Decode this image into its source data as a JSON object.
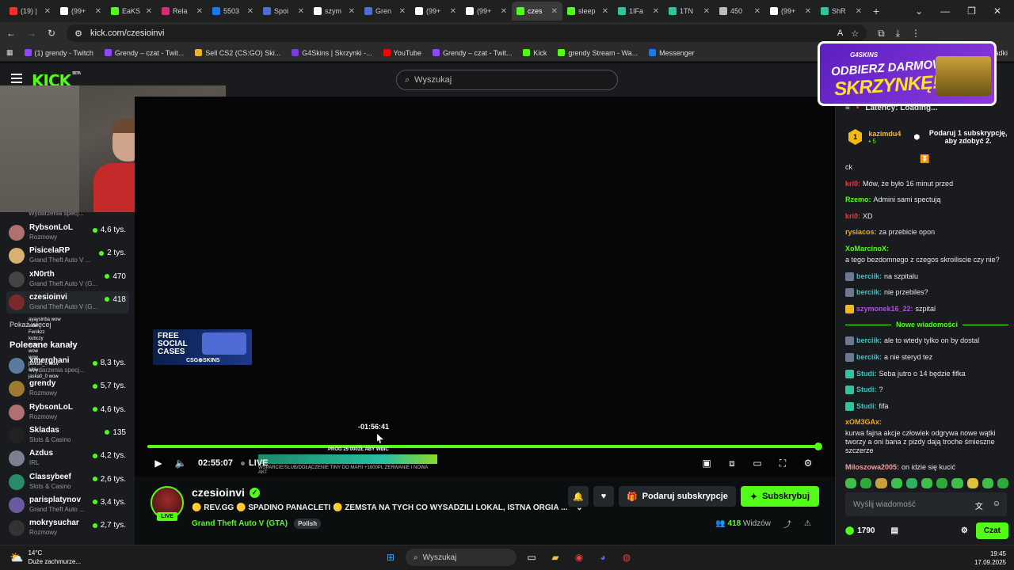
{
  "browser": {
    "tabs": [
      {
        "label": "(19) |",
        "color": "#ff2a2a"
      },
      {
        "label": "(99+",
        "color": "#ffffff"
      },
      {
        "label": "EaKS",
        "color": "#53fc18"
      },
      {
        "label": "Rela",
        "color": "#d62976"
      },
      {
        "label": "5503",
        "color": "#1877f2"
      },
      {
        "label": "Spoi",
        "color": "#4f6bd6"
      },
      {
        "label": "szym",
        "color": "#ffffff"
      },
      {
        "label": "Gren",
        "color": "#4f6bd6"
      },
      {
        "label": "(99+",
        "color": "#ffffff"
      },
      {
        "label": "(99+",
        "color": "#ffffff"
      },
      {
        "label": "czes",
        "color": "#53fc18",
        "active": true
      },
      {
        "label": "sleep",
        "color": "#53fc18"
      },
      {
        "label": "1IFa",
        "color": "#2ec4a0"
      },
      {
        "label": "1TN",
        "color": "#2ec4a0"
      },
      {
        "label": "450",
        "color": "#bbbbbb"
      },
      {
        "label": "(99+",
        "color": "#ffffff"
      },
      {
        "label": "ShR",
        "color": "#2ec4a0"
      }
    ],
    "url": "kick.com/czesioinvi",
    "bookmarks": [
      {
        "label": "(1) grendy - Twitch",
        "color": "#9146ff"
      },
      {
        "label": "Grendy – czat - Twit...",
        "color": "#9146ff"
      },
      {
        "label": "Sell CS2 (CS:GO) Ski...",
        "color": "#e8b52a"
      },
      {
        "label": "G4Skins | Skrzynki -...",
        "color": "#7b3ce0"
      },
      {
        "label": "YouTube",
        "color": "#ff0000"
      },
      {
        "label": "Grendy – czat - Twit...",
        "color": "#9146ff"
      },
      {
        "label": "Kick",
        "color": "#53fc18"
      },
      {
        "label": "grendy Stream - Wa...",
        "color": "#53fc18"
      },
      {
        "label": "Messenger",
        "color": "#1877f2"
      }
    ],
    "all_bookmarks_label": "tkie zakładki"
  },
  "kick": {
    "search_placeholder": "Wyszukaj"
  },
  "sidebar": {
    "top_partial": {
      "category": "Wydarzenia specj..."
    },
    "channels_top": [
      {
        "name": "RybsonLoL",
        "category": "Rozmowy",
        "viewers": "4,6 tys.",
        "color": "#b07070"
      },
      {
        "name": "PisicelaRP",
        "category": "Grand Theft Auto V ...",
        "viewers": "2 tys.",
        "color": "#d8b070"
      },
      {
        "name": "xN0rth",
        "category": "Grand Theft Auto V (G...",
        "viewers": "470",
        "color": "#444"
      },
      {
        "name": "czesioinvi",
        "category": "Grand Theft Auto V (G...",
        "viewers": "418",
        "color": "#7a2a2a",
        "selected": true
      }
    ],
    "show_more": "Pokaż więcej",
    "recommended_title": "Polecane kanały",
    "channels_rec": [
      {
        "name": "xmerghani",
        "category": "Wydarzenia specj...",
        "viewers": "8,3 tys.",
        "color": "#5a7aa0"
      },
      {
        "name": "grendy",
        "category": "Rozmowy",
        "viewers": "5,7 tys.",
        "color": "#a07a30"
      },
      {
        "name": "RybsonLoL",
        "category": "Rozmowy",
        "viewers": "4,6 tys.",
        "color": "#b07070"
      },
      {
        "name": "Skladas",
        "category": "Slots & Casino",
        "viewers": "135",
        "color": "#222"
      },
      {
        "name": "Azdus",
        "category": "IRL",
        "viewers": "4,2 tys.",
        "color": "#7a8090"
      },
      {
        "name": "Classybeef",
        "category": "Slots & Casino",
        "viewers": "2,6 tys.",
        "color": "#2a8a6a"
      },
      {
        "name": "parisplatynov",
        "category": "Grand Theft Auto ...",
        "viewers": "3,4 tys.",
        "color": "#6a5aa0"
      },
      {
        "name": "mokrysuchar",
        "category": "Rozmowy",
        "viewers": "2,7 tys.",
        "color": "#333"
      }
    ],
    "overlay_chat": [
      "ayaysinba wow",
      "wow",
      "Fenikzz",
      "kubczy",
      "wow",
      "wow",
      "wow",
      "jaska0_0 wow",
      "wow",
      "jaska0_0 wow"
    ]
  },
  "player": {
    "promo_title": "FREE SOCIAL CASES",
    "promo_brand": "CSG⊕SKINS",
    "progress": 1.0,
    "hover_time": "-01:56:41",
    "donation_label": "PRÓG 25 000ZŁ ABY WBIĆ",
    "donation_sub": "WSPARCIE/SLUB/DOŁĄCZENIE TINY DO MAFII +1600PL ZERWANIE I NOWA AKT",
    "donation_progress": 1.0,
    "time": "02:55:07",
    "live": "LIVE"
  },
  "stream": {
    "channel": "czesioinvi",
    "live_badge": "LIVE",
    "title": "🟡 REV.GG 🟡 SPADINO PANACLETI 🟡 ZEMSTA NA TYCH CO WYSADZILI LOKAL, ISTNA ORGIA ...",
    "game": "Grand Theft Auto V (GTA)",
    "tag": "Polish",
    "gift_label": "Podaruj subskrypcje",
    "subscribe_label": "Subskrybuj",
    "viewers_count": "418",
    "viewers_label": "Widzów"
  },
  "chat": {
    "header": "Latency: Loading...",
    "pinned": {
      "rank": "1",
      "user": "kazimdu4",
      "sub_count": "5",
      "message": "Podaruj 1 subskrypcję, aby zdobyć 2."
    },
    "messages_before": [
      {
        "user": "",
        "color": "#fff",
        "text": "ck"
      },
      {
        "user": "kri0",
        "color": "#e04040",
        "text": "Mów, że było 16 minut przed"
      },
      {
        "user": "Rzemo",
        "color": "#53fc18",
        "text": "Admini sami spectują"
      },
      {
        "user": "kri0",
        "color": "#e04040",
        "text": "XD"
      },
      {
        "user": "rysiacos",
        "color": "#f5a623",
        "text": "za przebicie opon"
      },
      {
        "user": "XoMarcinoX",
        "color": "#53fc18",
        "text": "a tego bezdomnego z czegos skroiliscie czy nie?"
      },
      {
        "user": "berciik",
        "color": "#40c0c0",
        "text": "na szpitalu",
        "badge": "#6a7a90"
      },
      {
        "user": "berciik",
        "color": "#40c0c0",
        "text": "nie przebiles?",
        "badge": "#6a7a90"
      },
      {
        "user": "szymonek16_22",
        "color": "#b050e0",
        "text": "szpital",
        "badge": "#f5b915"
      }
    ],
    "new_messages": "Nowe wiadomości",
    "messages_after": [
      {
        "user": "berciik",
        "color": "#40c0c0",
        "text": "ale to wtedy tylko on by dostal",
        "badge": "#6a7a90"
      },
      {
        "user": "berciik",
        "color": "#40c0c0",
        "text": "a nie steryd tez",
        "badge": "#6a7a90"
      },
      {
        "user": "Studi",
        "color": "#40c0c0",
        "text": "Seba jutro o 14 będzie fifka",
        "badge": "#2ec4a0"
      },
      {
        "user": "Studi",
        "color": "#40c0c0",
        "text": "?",
        "badge": "#2ec4a0"
      },
      {
        "user": "Studi",
        "color": "#40c0c0",
        "text": "fifa",
        "badge": "#2ec4a0"
      },
      {
        "user": "xOM3GAx",
        "color": "#f5a623",
        "text": "kurwa fajna akcje człowiek odgrywa nowe wątki tworzy a oni bana z pizdy dają troche śmieszne szczerze"
      },
      {
        "user": "Miloszowa2005",
        "color": "#f0a0a0",
        "text": "on idzie się kucić"
      }
    ],
    "input_placeholder": "Wyślij wiadomość",
    "points": "1790",
    "send_label": "Czat"
  },
  "ad": {
    "brand": "G4SKINS",
    "line1": "ODBIERZ DARMOWĄ",
    "line2": "SKRZYNKĘ!"
  },
  "taskbar": {
    "temp": "14°C",
    "weather": "Duże zachmurze...",
    "search": "Wyszukaj",
    "time": "19:45",
    "date": "17.09.2025"
  }
}
